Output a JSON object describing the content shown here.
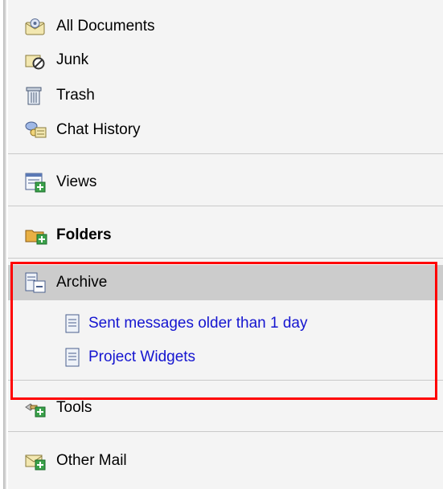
{
  "sidebar": {
    "items": [
      {
        "label": "All Documents",
        "icon": "all-documents-icon"
      },
      {
        "label": "Junk",
        "icon": "junk-icon"
      },
      {
        "label": "Trash",
        "icon": "trash-icon"
      },
      {
        "label": "Chat History",
        "icon": "chat-history-icon"
      }
    ],
    "views": {
      "label": "Views",
      "icon": "views-icon"
    },
    "folders": {
      "label": "Folders",
      "icon": "folders-icon"
    },
    "archive": {
      "label": "Archive",
      "icon": "archive-icon",
      "children": [
        {
          "label": "Sent messages older than 1 day",
          "icon": "archive-rule-icon"
        },
        {
          "label": "Project Widgets",
          "icon": "archive-rule-icon"
        }
      ]
    },
    "tools": {
      "label": "Tools",
      "icon": "tools-icon"
    },
    "other_mail": {
      "label": "Other Mail",
      "icon": "other-mail-icon"
    }
  },
  "colors": {
    "link": "#1515d0",
    "highlight_border": "#ff0000",
    "selected_row": "#cccccc"
  }
}
